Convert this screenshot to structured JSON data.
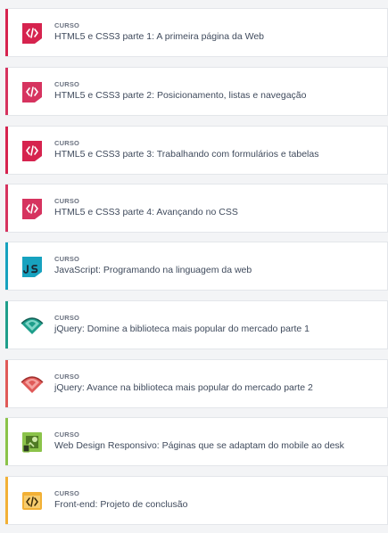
{
  "courses": [
    {
      "kind": "CURSO",
      "title": "HTML5 e CSS3 parte 1: A primeira página da Web",
      "icon": "html-code-icon",
      "color": "#d6234e"
    },
    {
      "kind": "CURSO",
      "title": "HTML5 e CSS3 parte 2: Posicionamento, listas e navegação",
      "icon": "html-code-icon",
      "color": "#d6335f"
    },
    {
      "kind": "CURSO",
      "title": "HTML5 e CSS3 parte 3: Trabalhando com formulários e tabelas",
      "icon": "html-code-icon",
      "color": "#d6234e"
    },
    {
      "kind": "CURSO",
      "title": "HTML5 e CSS3 parte 4: Avançando no CSS",
      "icon": "html-code-icon",
      "color": "#d6335f"
    },
    {
      "kind": "CURSO",
      "title": "JavaScript: Programando na linguagem da web",
      "icon": "javascript-icon",
      "color": "#17a2bf"
    },
    {
      "kind": "CURSO",
      "title": "jQuery: Domine a biblioteca mais popular do mercado parte 1",
      "icon": "jquery-icon",
      "color": "#1e9e8b"
    },
    {
      "kind": "CURSO",
      "title": "jQuery: Avance na biblioteca mais popular do mercado parte 2",
      "icon": "jquery-icon",
      "color": "#e05a58"
    },
    {
      "kind": "CURSO",
      "title": "Web Design Responsivo: Páginas que se adaptam do mobile ao desk",
      "icon": "responsive-design-icon",
      "color": "#8bc34a"
    },
    {
      "kind": "CURSO",
      "title": "Front-end: Projeto de conclusão",
      "icon": "code-window-icon",
      "color": "#f2b035"
    }
  ]
}
